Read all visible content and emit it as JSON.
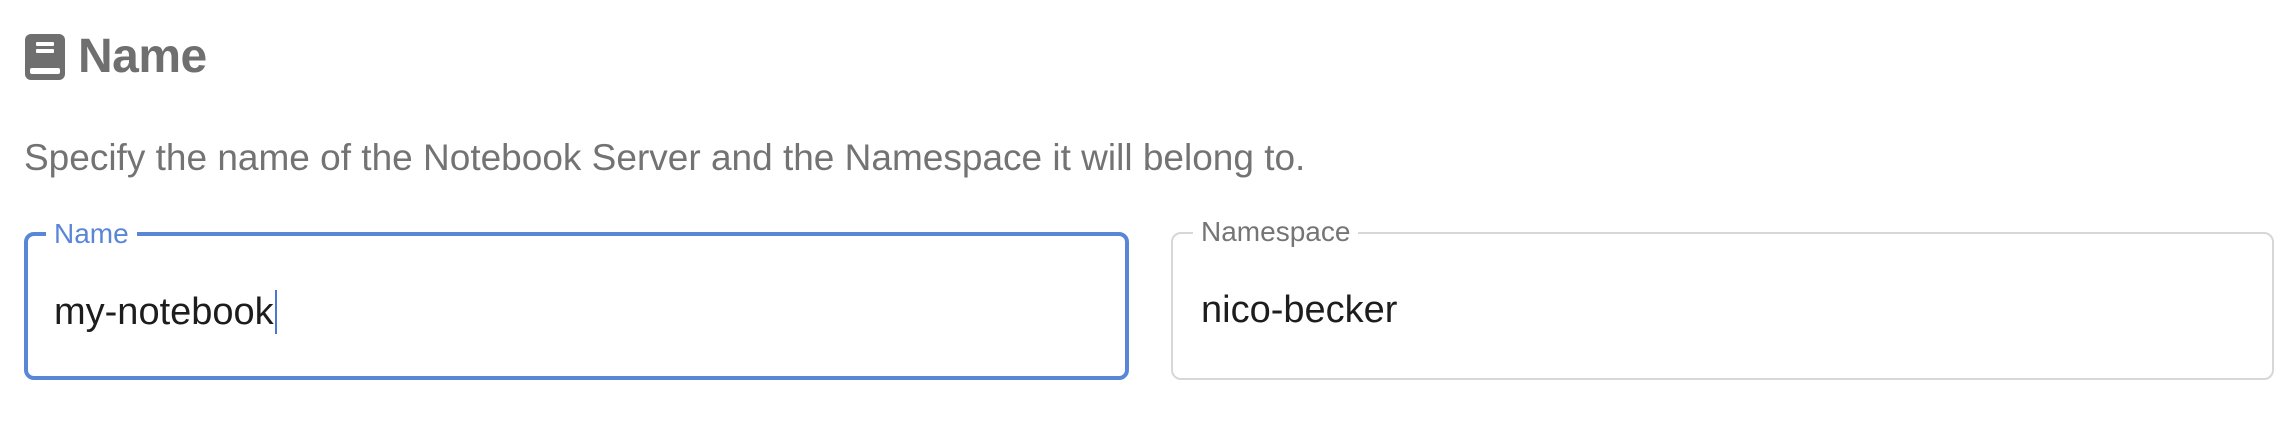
{
  "section": {
    "icon": "book-icon",
    "title": "Name",
    "description": "Specify the name of the Notebook Server and the Namespace it will belong to."
  },
  "fields": {
    "name": {
      "label": "Name",
      "value": "my-notebook",
      "focused": true
    },
    "namespace": {
      "label": "Namespace",
      "value": "nico-becker",
      "focused": false
    }
  },
  "colors": {
    "accent": "#5a86d8",
    "muted_text": "#737373",
    "border": "#d7d7d7"
  }
}
